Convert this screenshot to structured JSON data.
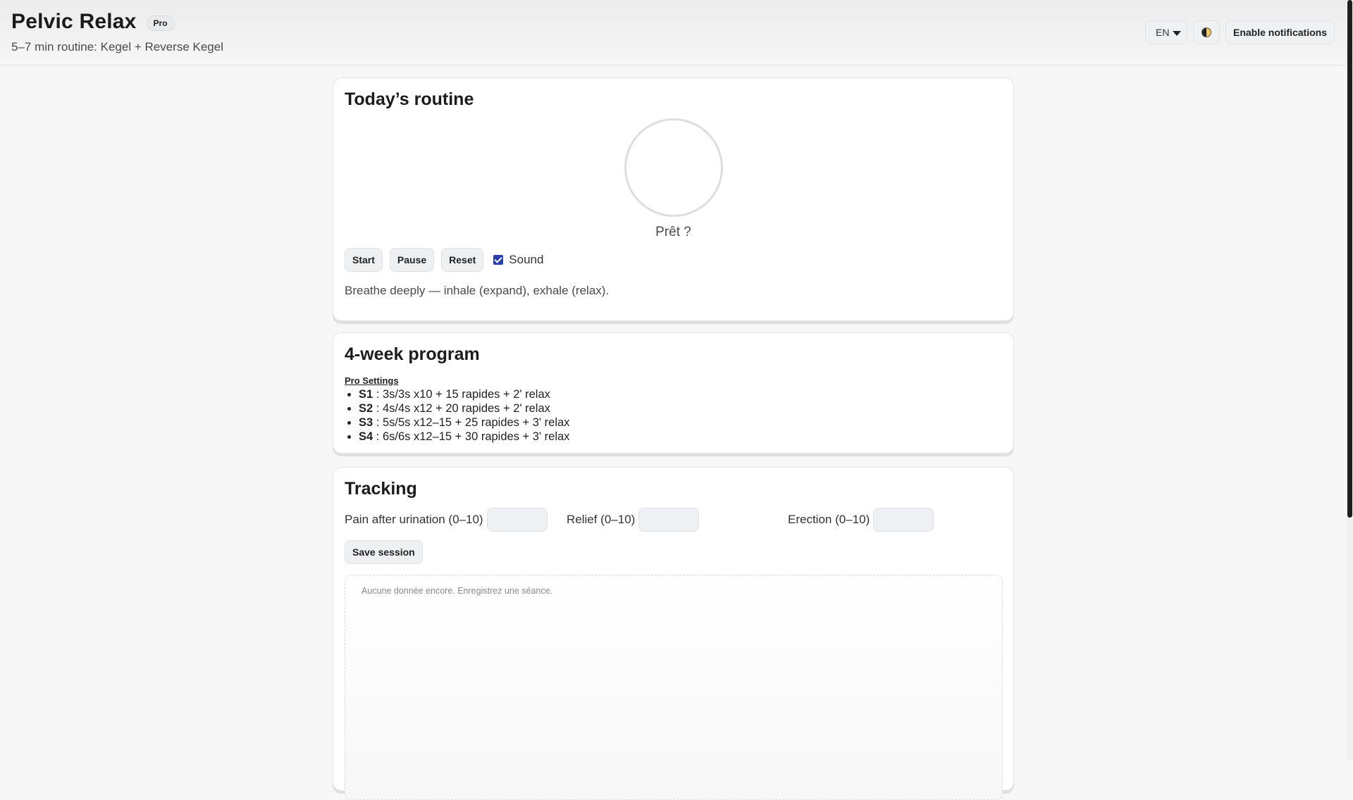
{
  "header": {
    "title": "Pelvic Relax",
    "badge": "Pro",
    "subtitle": "5–7 min routine: Kegel + Reverse Kegel",
    "language": "EN",
    "theme_icon": "half-moon-contrast-icon",
    "notifications_label": "Enable notifications"
  },
  "routine": {
    "title": "Today’s routine",
    "status": "Prêt ?",
    "buttons": {
      "start": "Start",
      "pause": "Pause",
      "reset": "Reset"
    },
    "sound_label": "Sound",
    "sound_checked": true,
    "hint": "Breathe deeply — inhale (expand), exhale (relax)."
  },
  "program": {
    "title": "4-week program",
    "settings_link": "Pro Settings",
    "weeks": [
      {
        "label": "S1",
        "text": " : 3s/3s x10 + 15 rapides + 2' relax"
      },
      {
        "label": "S2",
        "text": " : 4s/4s x12 + 20 rapides + 2' relax"
      },
      {
        "label": "S3",
        "text": " : 5s/5s x12–15 + 25 rapides + 3' relax"
      },
      {
        "label": "S4",
        "text": " : 6s/6s x12–15 + 30 rapides + 3' relax"
      }
    ]
  },
  "tracking": {
    "title": "Tracking",
    "fields": {
      "pain": {
        "label": "Pain after urination (0–10)",
        "value": ""
      },
      "relief": {
        "label": "Relief (0–10)",
        "value": ""
      },
      "erection": {
        "label": "Erection (0–10)",
        "value": ""
      }
    },
    "save_label": "Save session",
    "empty_message": "Aucune donnée encore. Enregistrez une séance."
  },
  "colors": {
    "accent_checkbox": "#2a3fb0",
    "background": "#f7f7f7",
    "card": "#ffffff"
  }
}
